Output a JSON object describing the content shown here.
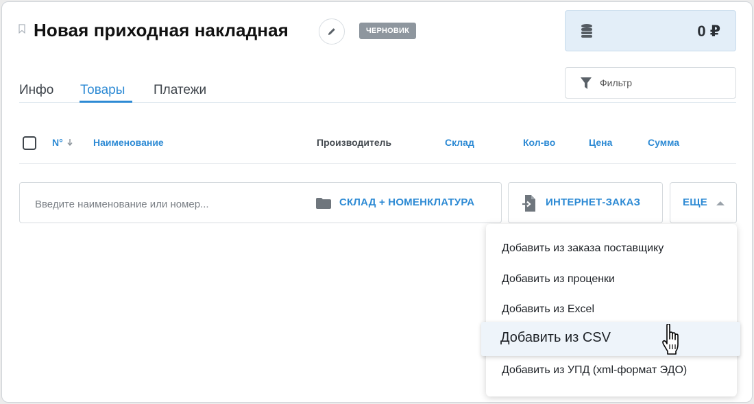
{
  "document": {
    "title": "Новая приходная накладная",
    "status_badge": "ЧЕРНОВИК",
    "balance": "0 ₽"
  },
  "filter": {
    "label": "Фильтр"
  },
  "tabs": [
    {
      "label": "Инфо",
      "active": false
    },
    {
      "label": "Товары",
      "active": true
    },
    {
      "label": "Платежи",
      "active": false
    }
  ],
  "table": {
    "columns": [
      "N°",
      "Наименование",
      "Производитель",
      "Склад",
      "Кол-во",
      "Цена",
      "Сумма"
    ],
    "sort_icon": "arrow-down-icon"
  },
  "add_bar": {
    "search_placeholder": "Введите наименование или номер...",
    "warehouse_button": "СКЛАД + НОМЕНКЛАТУРА",
    "internet_order_button": "ИНТЕРНЕТ-ЗАКАЗ",
    "more_button": "ЕЩЕ"
  },
  "more_menu": {
    "items": [
      "Добавить из заказа поставщику",
      "Добавить из проценки",
      "Добавить из Excel",
      "Добавить из CSV",
      "Добавить из УПД (xml-формат ЭДО)"
    ],
    "hovered": "Добавить из CSV"
  },
  "colors": {
    "accent": "#2d8ad4",
    "badge": "#8e969e",
    "balance_bg": "#e3eef8",
    "text": "#111111"
  },
  "icons": [
    "bookmark-icon",
    "pencil-icon",
    "coins-icon",
    "filter-icon",
    "folder-icon",
    "import-file-icon",
    "caret-up-icon",
    "hand-cursor-icon"
  ]
}
